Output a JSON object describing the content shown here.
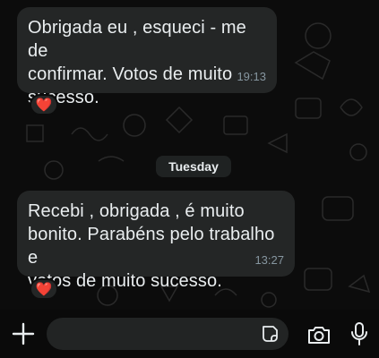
{
  "chat": {
    "messages": [
      {
        "text": "Obrigada eu , esqueci - me  de\nconfirmar. Votos de muito\nsucesso.",
        "time": "19:13",
        "reaction": "❤️"
      },
      {
        "text": "Recebi , obrigada , é muito\nbonito. Parabéns pelo trabalho e\nvotos de muito sucesso.",
        "time": "13:27",
        "reaction": "❤️"
      }
    ],
    "date_separator": "Tuesday"
  },
  "composer": {
    "placeholder": "",
    "icons": {
      "attach": "plus-icon",
      "sticker": "sticker-icon",
      "camera": "camera-icon",
      "mic": "mic-icon"
    }
  },
  "colors": {
    "background": "#0c0c0c",
    "bubble": "#242626",
    "text": "#e9edef",
    "timestamp": "#8696a0",
    "reaction_heart": "#e0245e"
  }
}
